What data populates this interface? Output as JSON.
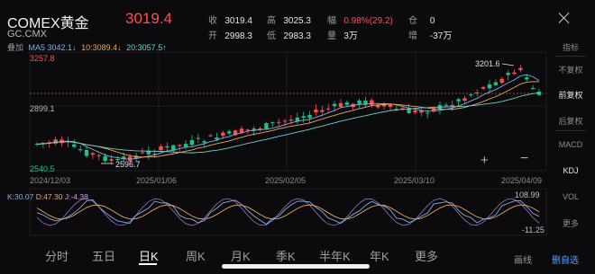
{
  "header": {
    "title": "COMEX黄金",
    "code": "GC.CMX",
    "price": "3019.4",
    "stats": {
      "shou_label": "收",
      "shou": "3019.4",
      "gao_label": "高",
      "gao": "3025.3",
      "fu_label": "幅",
      "fu": "0.98%(29.2)",
      "cang_label": "仓",
      "cang": "0",
      "kai_label": "开",
      "kai": "2998.3",
      "di_label": "低",
      "di": "2983.3",
      "liang_label": "量",
      "liang": "3万",
      "zeng_label": "增",
      "zeng": "-37万"
    }
  },
  "ma_legend": {
    "overlay": "叠加",
    "ma5": "MA5 3042.1↓",
    "ma10": "10:3089.4↓",
    "ma20": "20:3057.5↑"
  },
  "axis": {
    "y_top": "3257.8",
    "y_mid": "2899.1",
    "y_bottom": "2540.5",
    "high_marker": "3201.6",
    "low_marker": "2596.7",
    "dates": [
      "2024/12/03",
      "2025/01/06",
      "2025/02/05",
      "2025/03/10",
      "2025/04/09"
    ]
  },
  "kdj": {
    "k": "K:30.07",
    "d": "D:47.30",
    "j": "J:-4.38",
    "top": "108.99",
    "bottom": "-11.25"
  },
  "side_menu": {
    "indicator": "指标",
    "no_adjust": "不复权",
    "pre_adjust": "前复权",
    "post_adjust": "后复权",
    "macd": "MACD",
    "kdj": "KDJ",
    "vol": "VOL",
    "more": "更多"
  },
  "tabs": [
    "分时",
    "五日",
    "日K",
    "周K",
    "月K",
    "季K",
    "半年K",
    "年K",
    "更多"
  ],
  "active_tab": "日K",
  "bottom_buttons": {
    "draw": "画线",
    "watchlist": "删自选"
  },
  "colors": {
    "up": "#ff4d4f",
    "down": "#1ec08a",
    "ma5": "#7fb0e8",
    "ma10": "#f0a45a",
    "ma20": "#6fd1c9"
  }
}
